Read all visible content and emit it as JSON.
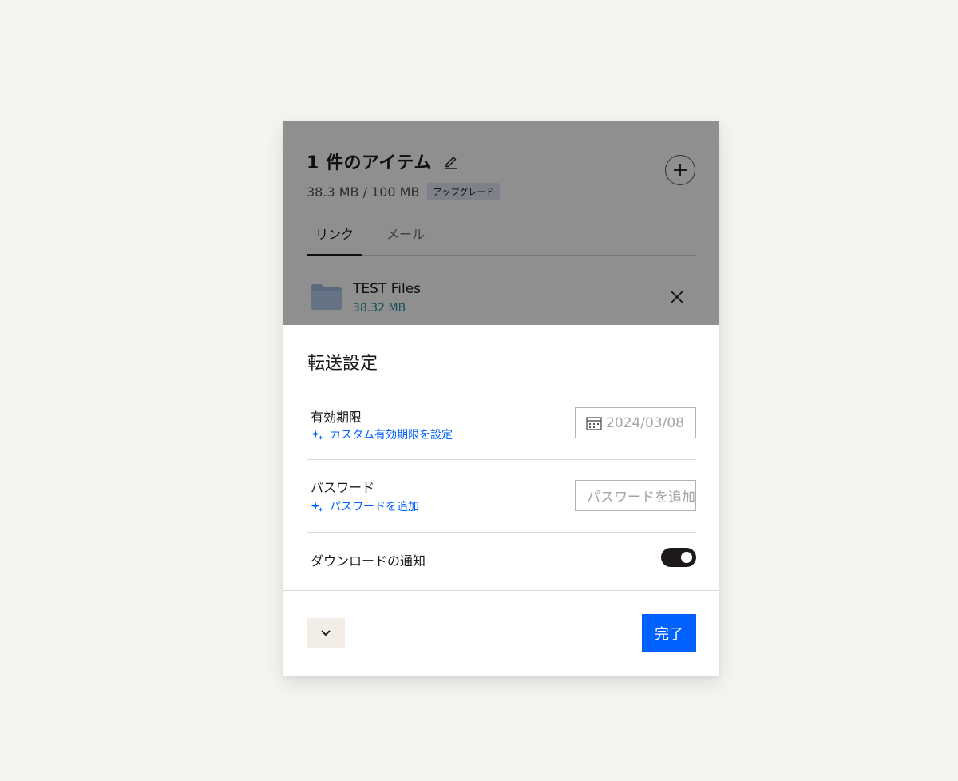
{
  "header": {
    "title": "1 件のアイテム",
    "usage": "38.3 MB / 100 MB",
    "upgrade_label": "アップグレード"
  },
  "tabs": [
    {
      "label": "リンク",
      "selected": true
    },
    {
      "label": "メール",
      "selected": false
    }
  ],
  "file": {
    "name": "TEST Files",
    "size": "38.32 MB"
  },
  "settings": {
    "title": "転送設定",
    "expiry": {
      "label": "有効期限",
      "link": "カスタム有効期限を設定",
      "value": "2024/03/08"
    },
    "password": {
      "label": "パスワード",
      "link": "パスワードを追加",
      "placeholder": "パスワードを追加"
    },
    "notify": {
      "label": "ダウンロードの通知",
      "enabled": true
    }
  },
  "footer": {
    "done_label": "完了"
  },
  "colors": {
    "accent": "#0061fe",
    "background": "#f5f4f0",
    "toggle_on": "#1e1919"
  },
  "icons": [
    "pencil-icon",
    "plus-icon",
    "folder-icon",
    "close-icon",
    "sparkle-icon",
    "calendar-icon",
    "chevron-down-icon"
  ]
}
